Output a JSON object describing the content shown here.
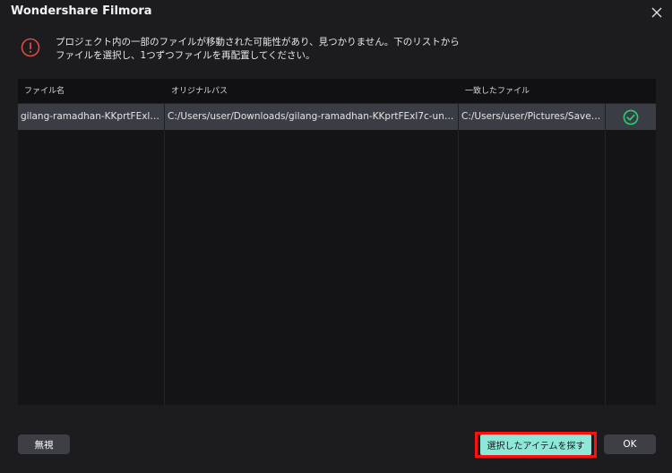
{
  "window": {
    "title": "Wondershare Filmora"
  },
  "message": {
    "text": "プロジェクト内の一部のファイルが移動された可能性があり、見つかりません。下のリストから\nファイルを選択し、1つずつファイルを再配置してください。"
  },
  "table": {
    "columns": [
      "ファイル名",
      "オリジナルパス",
      "一致したファイル"
    ],
    "rows": [
      {
        "file_name": "gilang-ramadhan-KKprtFExl7...",
        "original_path": "C:/Users/user/Downloads/gilang-ramadhan-KKprtFExl7c-unspl...",
        "matched_file": "C:/Users/user/Pictures/Saved ..."
      }
    ]
  },
  "buttons": {
    "ignore": "無視",
    "find_selected": "選択したアイテムを探す",
    "ok": "OK"
  },
  "colors": {
    "accent": "#8ee8d8",
    "warning": "#e04848",
    "success": "#2ecc71",
    "highlight_frame": "#ff1010"
  }
}
